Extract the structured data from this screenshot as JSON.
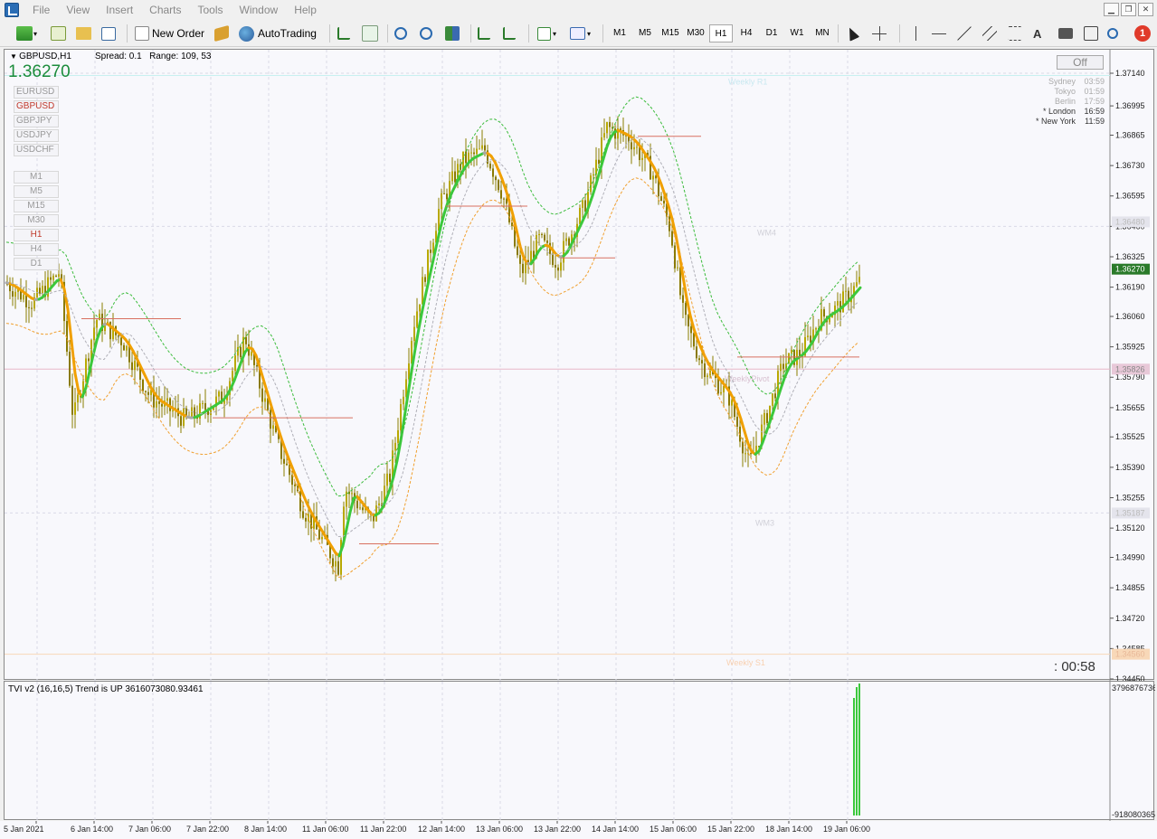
{
  "menu": [
    "File",
    "View",
    "Insert",
    "Charts",
    "Tools",
    "Window",
    "Help"
  ],
  "toolbar": {
    "new_order": "New Order",
    "auto_trading": "AutoTrading",
    "timeframes": [
      "M1",
      "M5",
      "M15",
      "M30",
      "H1",
      "H4",
      "D1",
      "W1",
      "MN"
    ],
    "active_tf": "H1",
    "notification_count": "1"
  },
  "chart": {
    "symbol": "GBPUSD,H1",
    "spread": "Spread: 0.1",
    "range": "Range: 109, 53",
    "bid": "1.36270",
    "off_label": "Off",
    "countdown": ":  00:58",
    "symbols": [
      "EURUSD",
      "GBPUSD",
      "GBPJPY",
      "USDJPY",
      "USDCHF"
    ],
    "active_symbol": "GBPUSD",
    "timeframes": [
      "M1",
      "M5",
      "M15",
      "M30",
      "H1",
      "H4",
      "D1"
    ],
    "sessions": [
      {
        "name": "Sydney",
        "time": "03:59",
        "open": false
      },
      {
        "name": "Tokyo",
        "time": "01:59",
        "open": false
      },
      {
        "name": "Berlin",
        "time": "17:59",
        "open": false
      },
      {
        "name": "* London",
        "time": "16:59",
        "open": true
      },
      {
        "name": "* New York",
        "time": "11:59",
        "open": true
      }
    ],
    "price_labels": [
      "1.37140",
      "1.36995",
      "1.36865",
      "1.36730",
      "1.36595",
      "1.36460",
      "1.36325",
      "1.36190",
      "1.36060",
      "1.35925",
      "1.35790",
      "1.35655",
      "1.35525",
      "1.35390",
      "1.35255",
      "1.35120",
      "1.34990",
      "1.34855",
      "1.34720",
      "1.34585",
      "1.34450"
    ],
    "highlight_prices": {
      "current": "1.36270",
      "pivot": "1.35826",
      "wm4": "1.36480",
      "wm3": "1.35187",
      "s1": "1.34560"
    },
    "level_labels": {
      "r1": "Weekly R1",
      "wm4": "WM4",
      "pivot": "WeeklyPivot",
      "wm3": "WM3",
      "s1": "Weekly S1"
    }
  },
  "indicator": {
    "label": "TVI v2 (16,16,5) Trend is UP 3616073080.93461",
    "top_value": "3796876736",
    "bottom_value": "-918080365"
  },
  "xaxis_labels": [
    "5 Jan 2021",
    "6 Jan 14:00",
    "7 Jan 06:00",
    "7 Jan 22:00",
    "8 Jan 14:00",
    "11 Jan 06:00",
    "11 Jan 22:00",
    "12 Jan 14:00",
    "13 Jan 06:00",
    "13 Jan 22:00",
    "14 Jan 14:00",
    "15 Jan 06:00",
    "15 Jan 22:00",
    "18 Jan 14:00",
    "19 Jan 06:00"
  ],
  "colors": {
    "bull": "#b8a800",
    "bear": "#8a7a00",
    "ma_up": "#3cc83c",
    "ma_down": "#f0a000",
    "ma_neutral": "#a8a8a8",
    "hist": "#3cc83c"
  }
}
